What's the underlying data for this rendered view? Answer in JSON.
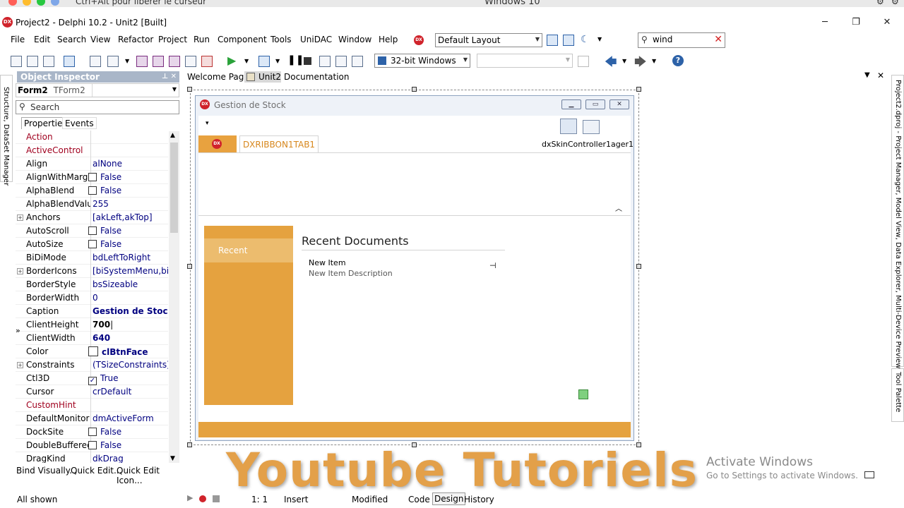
{
  "overlay": {
    "hint": "Ctrl+Alt pour libérer le curseur",
    "vm_title": "Windows 10"
  },
  "window": {
    "title": "Project2 - Delphi 10.2 - Unit2 [Built]"
  },
  "menu": [
    "File",
    "Edit",
    "Search",
    "View",
    "Refactor",
    "Project",
    "Run",
    "Component",
    "Tools",
    "UniDAC",
    "Window",
    "Help"
  ],
  "toolbar": {
    "layout": "Default Layout",
    "search_value": "wind",
    "platform": "32-bit Windows",
    "config": ""
  },
  "object_inspector": {
    "title": "Object Inspector",
    "selected_object": "Form2",
    "selected_type": "TForm2",
    "search_placeholder": "Search",
    "tabs": [
      "Properties",
      "Events"
    ],
    "properties": [
      {
        "name": "Action",
        "value": "",
        "style": "maroon"
      },
      {
        "name": "ActiveControl",
        "value": "",
        "style": "maroon"
      },
      {
        "name": "Align",
        "value": "alNone"
      },
      {
        "name": "AlignWithMargins",
        "value": "False",
        "check": false
      },
      {
        "name": "AlphaBlend",
        "value": "False",
        "check": false
      },
      {
        "name": "AlphaBlendValue",
        "value": "255"
      },
      {
        "name": "Anchors",
        "value": "[akLeft,akTop]",
        "expand": true
      },
      {
        "name": "AutoScroll",
        "value": "False",
        "check": false
      },
      {
        "name": "AutoSize",
        "value": "False",
        "check": false
      },
      {
        "name": "BiDiMode",
        "value": "bdLeftToRight"
      },
      {
        "name": "BorderIcons",
        "value": "[biSystemMenu,biMinimize,biMaximize]",
        "expand": true
      },
      {
        "name": "BorderStyle",
        "value": "bsSizeable"
      },
      {
        "name": "BorderWidth",
        "value": "0"
      },
      {
        "name": "Caption",
        "value": "Gestion de Stock",
        "bold": true
      },
      {
        "name": "ClientHeight",
        "value": "700",
        "bold": true,
        "editing": true
      },
      {
        "name": "ClientWidth",
        "value": "640",
        "bold": true
      },
      {
        "name": "Color",
        "value": "clBtnFace",
        "bold": true,
        "swatch": true
      },
      {
        "name": "Constraints",
        "value": "(TSizeConstraints)",
        "expand": true
      },
      {
        "name": "Ctl3D",
        "value": "True",
        "check": true
      },
      {
        "name": "Cursor",
        "value": "crDefault"
      },
      {
        "name": "CustomHint",
        "value": "",
        "style": "maroon"
      },
      {
        "name": "DefaultMonitor",
        "value": "dmActiveForm"
      },
      {
        "name": "DockSite",
        "value": "False",
        "check": false
      },
      {
        "name": "DoubleBuffered",
        "value": "False",
        "check": false
      },
      {
        "name": "DragKind",
        "value": "dkDrag"
      }
    ],
    "footer_links": [
      "Bind Visually...",
      "Quick Edit...",
      "Quick Edit Icon..."
    ],
    "status": "All shown"
  },
  "side_tabs": {
    "left": "Structure, DataSet Manager",
    "right_top": "Project2.dproj - Project Manager, Model View, Data Explorer, Multi-Device Preview",
    "right_bottom": "Tool Palette"
  },
  "doc_tabs": [
    "Welcome Page",
    "Unit2",
    "Documentation"
  ],
  "designer": {
    "form_caption": "Gestion de Stock",
    "ribbon_tab": "DXRIBBON1TAB1",
    "component": "dxSkinController1ager1",
    "backstage_item": "Recent",
    "recent_title": "Recent Documents",
    "new_item": "New Item",
    "new_item_desc": "New Item Description"
  },
  "watermark": "Youtube Tutoriels",
  "activation": {
    "title": "Activate Windows",
    "subtitle": "Go to Settings to activate Windows."
  },
  "statusbar": {
    "position": "1:  1",
    "mode": "Insert",
    "state": "Modified",
    "views": [
      "Code",
      "Design",
      "History"
    ]
  },
  "colors": {
    "accent_orange": "#e5a23f",
    "delphi_red": "#d0232b",
    "inspector_header": "#a9b6c8"
  }
}
